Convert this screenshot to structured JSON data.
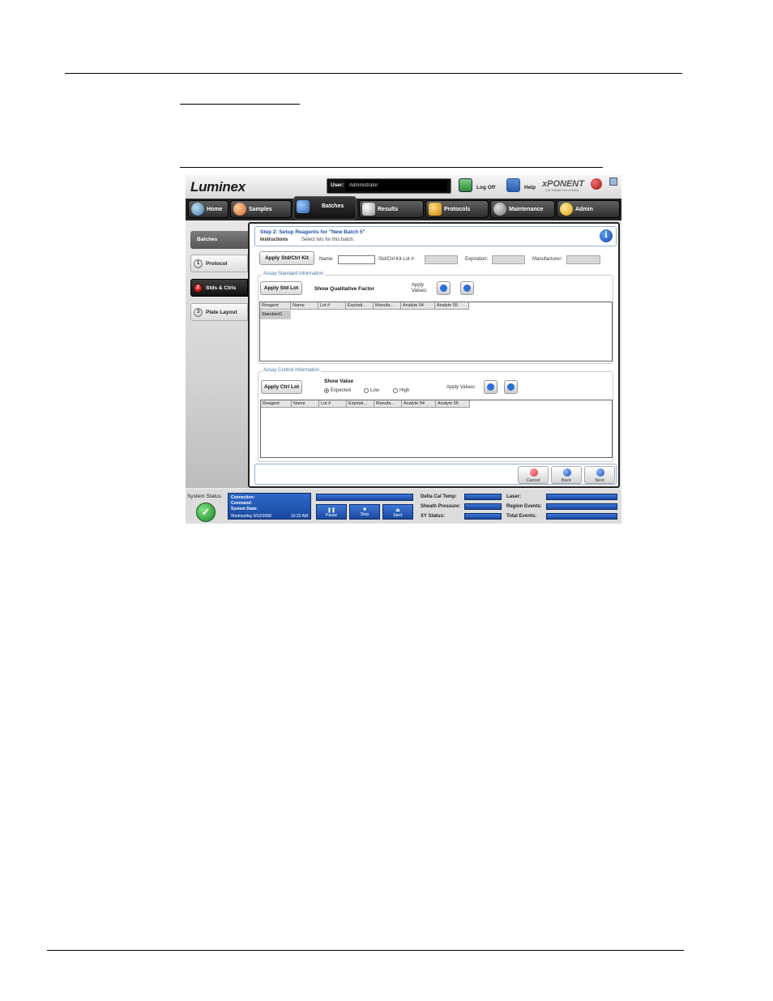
{
  "app": {
    "logo": "Luminex",
    "user_label": "User:",
    "user_value": "Administrator",
    "logoff_label": "Log Off",
    "help_label": "Help",
    "brand": "xPONENT",
    "brand_sub": "SOFTWARE SOLUTIONS"
  },
  "nav": {
    "tabs": [
      {
        "label": "Home"
      },
      {
        "label": "Samples"
      },
      {
        "label": "Batches"
      },
      {
        "label": "Results"
      },
      {
        "label": "Protocols"
      },
      {
        "label": "Maintenance"
      },
      {
        "label": "Admin"
      }
    ]
  },
  "sidebar": {
    "header": "Batches",
    "steps": [
      {
        "num": "1",
        "label": "Protocol"
      },
      {
        "num": "2",
        "label": "Stds & Ctrls"
      },
      {
        "num": "3",
        "label": "Plate Layout"
      }
    ]
  },
  "instructions": {
    "title": "Step 2: Setup Reagents for \"New Batch 5\"",
    "label": "Instructions",
    "text": "Select lots for this batch."
  },
  "kit": {
    "apply_button": "Apply Std/Ctrl Kit",
    "name_label": "Name:",
    "lot_label": "Std/Ctrl Kit Lot #:",
    "expiration_label": "Expiration:",
    "manufacturer_label": "Manufacturer:"
  },
  "standard": {
    "legend": "Assay Standard Information",
    "apply_button": "Apply Std Lot",
    "qual_label": "Show Qualitative Factor",
    "apply_values_label": "Apply\nValues:",
    "columns": [
      "Reagent",
      "Name",
      "Lot #",
      "Expirati...",
      "Manufa...",
      "Analyte 54",
      "Analyte 55"
    ],
    "rows": [
      {
        "reagent": "Standard1"
      }
    ]
  },
  "control": {
    "legend": "Assay Control Information",
    "apply_button": "Apply Ctrl Lot",
    "show_value_label": "Show Value",
    "options": [
      "Expected",
      "Low",
      "High"
    ],
    "selected": "Expected",
    "apply_values_label": "Apply Values:",
    "columns": [
      "Reagent",
      "Name",
      "Lot #",
      "Expirati...",
      "Manufa...",
      "Analyte 54",
      "Analyte 55"
    ]
  },
  "footer_nav": {
    "cancel": "Cancel",
    "back": "Back",
    "next": "Next"
  },
  "status": {
    "system_status_label": "System Status",
    "connection_label": "Connection:",
    "command_label": "Command:",
    "system_state_label": "System State:",
    "date": "Wednesday 9/12/2008",
    "time": "10:22 AM",
    "pause": "Pause",
    "stop": "Stop",
    "eject": "Eject",
    "delta_cal_temp": "Delta Cal Temp:",
    "sheath_pressure": "Sheath Pressure:",
    "xy_status": "XY Status:",
    "laser": "Laser:",
    "region_events": "Region Events:",
    "total_events": "Total Events:"
  },
  "colors": {
    "accent_blue": "#1f4fa8",
    "status_green": "#1f8a2a",
    "step_red": "#a00000"
  }
}
